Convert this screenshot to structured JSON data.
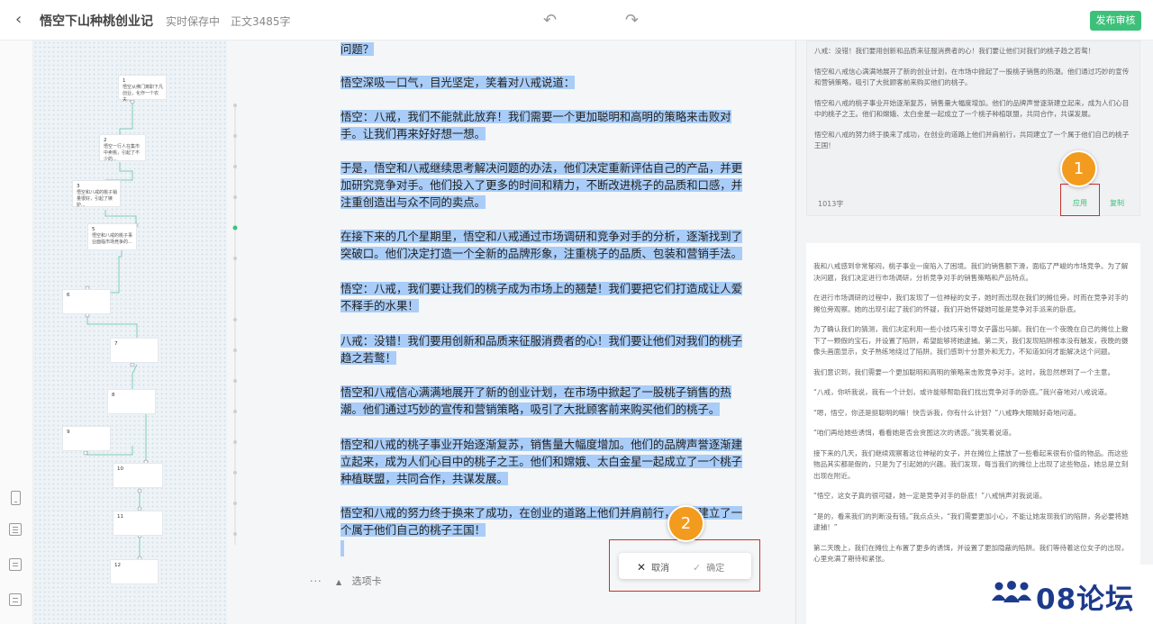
{
  "header": {
    "title": "悟空下山种桃创业记",
    "save_status": "实时保存中",
    "word_count": "正文3485字",
    "publish_label": "发布审核"
  },
  "mindmap": {
    "nodes": [
      {
        "num": "1",
        "text": "悟空从佛门离职下凡创业，化作一个农夫..."
      },
      {
        "num": "2",
        "text": "悟空一行人在集市中卖桃，引起了不少的..."
      },
      {
        "num": "3",
        "text": "悟空和八戒的桃子销量很好，引起了嫉妒..."
      },
      {
        "num": "5",
        "text": "悟空和八戒的桃子事业面临市场竞争的..."
      },
      {
        "num": "6",
        "text": ""
      },
      {
        "num": "7",
        "text": ""
      },
      {
        "num": "8",
        "text": ""
      },
      {
        "num": "9",
        "text": ""
      },
      {
        "num": "10",
        "text": ""
      },
      {
        "num": "11",
        "text": ""
      },
      {
        "num": "12",
        "text": ""
      }
    ]
  },
  "editor": {
    "paragraphs": [
      "问题？",
      "悟空深吸一口气，目光坚定，笑着对八戒说道：",
      "悟空：八戒，我们不能就此放弃！我们需要一个更加聪明和高明的策略来击败对手。让我们再来好好想一想。",
      "于是，悟空和八戒继续思考解决问题的办法，他们决定重新评估自己的产品，并更加研究竞争对手。他们投入了更多的时间和精力，不断改进桃子的品质和口感，并注重创造出与众不同的卖点。",
      "在接下来的几个星期里，悟空和八戒通过市场调研和竞争对手的分析，逐渐找到了突破口。他们决定打造一个全新的品牌形象，注重桃子的品质、包装和营销手法。",
      "悟空：八戒，我们要让我们的桃子成为市场上的翘楚！我们要把它们打造成让人爱不释手的水果！",
      "八戒：没错！我们要用创新和品质来征服消费者的心！我们要让他们对我们的桃子趋之若鹜！",
      "悟空和八戒信心满满地展开了新的创业计划，在市场中掀起了一股桃子销售的热潮。他们通过巧妙的宣传和营销策略，吸引了大批顾客前来购买他们的桃子。",
      "悟空和八戒的桃子事业开始逐渐复苏，销售量大幅度增加。他们的品牌声誉逐渐建立起来，成为人们心目中的桃子之王。他们和嫦娥、太白金星一起成立了一个桃子种植联盟，共同合作，共谋发展。",
      "悟空和八戒的努力终于换来了成功，在创业的道路上他们并肩前行，共同建立了一个属于他们自己的桃子王国！"
    ],
    "bottom_tab_label": "选项卡",
    "confirm": {
      "cancel_label": "取消",
      "ok_label": "确定"
    }
  },
  "badges": {
    "one": "1",
    "two": "2"
  },
  "right_panel": {
    "card1": {
      "paragraphs": [
        "八戒：没错！我们要用创新和品质来征服消费者的心！我们要让他们对我们的桃子趋之若鹜！",
        "悟空和八戒信心满满地展开了新的创业计划，在市场中掀起了一股桃子销售的热潮。他们通过巧妙的宣传和营销策略，吸引了大批顾客前来购买他们的桃子。",
        "悟空和八戒的桃子事业开始逐渐复苏，销售量大幅度增加。他们的品牌声誉逐渐建立起来，成为人们心目中的桃子之王。他们和嫦娥、太白金星一起成立了一个桃子种植联盟，共同合作，共谋发展。",
        "悟空和八戒的努力终于换来了成功，在创业的道路上他们并肩前行，共同建立了一个属于他们自己的桃子王国！"
      ],
      "count": "1013字",
      "apply_label": "应用",
      "copy_label": "复制"
    },
    "card2": {
      "paragraphs": [
        "我和八戒感到非常郁闷，桃子事业一度陷入了困境。我们的销售额下滑，面临了严峻的市场竞争。为了解决问题，我们决定进行市场调研，分析竞争对手的销售策略和产品特点。",
        "在进行市场调研的过程中，我们发现了一位神秘的女子，她时而出现在我们的摊位旁，时而在竞争对手的摊位旁观察。她的出现引起了我们的怀疑，我们开始怀疑她可能是竞争对手派来的卧底。",
        "为了确认我们的猜测，我们决定利用一些小技巧来引导女子露出马脚。我们在一个夜晚在自己的摊位上撒下了一颗假的宝石，并设置了陷阱，希望能够将她逮捕。第二天，我们发现陷阱根本没有触发，夜晚的摄像头画面显示，女子熟练地绕过了陷阱。我们感到十分意外和无力，不知道如何才能解决这个问题。",
        "我们意识到，我们需要一个更加聪明和高明的策略来击败竞争对手。这时，我忽然想到了一个主意。",
        "“八戒，你听我说，我有一个计划，或许能够帮助我们找出竞争对手的卧底。”我兴奋地对八戒说道。",
        "“嗯，悟空，你还是挺聪明的嘛！快告诉我，你有什么计划？”八戒睁大眼睛好奇地问道。",
        "“咱们再给她些诱饵，看看她是否会贪图这次的诱惑。”我笑着说道。",
        "接下来的几天，我们继续观察着这位神秘的女子，并在摊位上摆放了一些看起来很有价值的物品。而这些物品其实都是假的，只是为了引起她的兴趣。我们发现，每当我们的摊位上出现了这些物品，她总是立刻出现在附近。",
        "“悟空，这女子真的很可疑，她一定是竞争对手的卧底！”八戒悄声对我说道。",
        "“是的，看来我们的判断没有错。”我点点头，“我们需要更加小心，不能让她发现我们的陷阱，务必要将她逮捕！”",
        "第二天晚上，我们在摊位上布置了更多的诱饵，并设置了更加隐蔽的陷阱。我们等待着这位女子的出现，心里充满了期待和紧张。"
      ]
    }
  },
  "watermark": {
    "text": "08论坛"
  }
}
